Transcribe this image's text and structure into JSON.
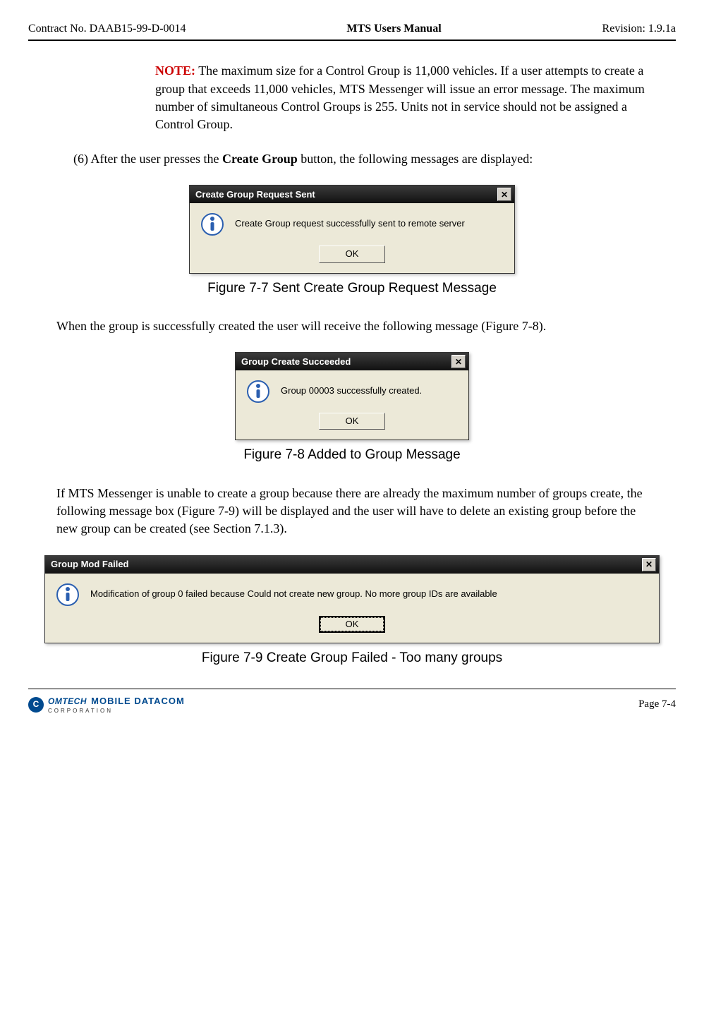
{
  "header": {
    "left": "Contract No. DAAB15-99-D-0014",
    "center": "MTS Users Manual",
    "right": "Revision:  1.9.1a"
  },
  "note": {
    "label": "NOTE:",
    "text": " The maximum size for a Control Group is 11,000 vehicles. If a user attempts to create a group that exceeds 11,000 vehicles, MTS Messenger will issue an error message.  The maximum number of simultaneous Control Groups is 255. Units not in service should not be assigned a Control Group."
  },
  "item6": {
    "number": "(6)",
    "pre": " After the user presses the ",
    "bold": "Create Group",
    "post": " button, the following messages are displayed:"
  },
  "dialog1": {
    "title": "Create Group Request Sent",
    "message": "Create Group request successfully sent to remote server",
    "ok": "OK"
  },
  "caption1": "Figure 7-7     Sent Create Group Request Message",
  "para2": "When the group is successfully created the user will receive the following message (Figure 7-8).",
  "dialog2": {
    "title": "Group Create Succeeded",
    "message": "Group 00003 successfully created.",
    "ok": "OK"
  },
  "caption2": "Figure 7-8     Added to Group Message",
  "para3": "If MTS Messenger is unable to create a group because there are already the maximum number of groups create, the following message box (Figure 7-9) will be displayed and the user will have to delete an existing group before the new group can be created (see Section 7.1.3).",
  "dialog3": {
    "title": "Group Mod Failed",
    "message": "Modification of group 0 failed because Could not create new group.  No more group IDs are available",
    "ok": "OK"
  },
  "caption3": "Figure 7-9     Create Group Failed - Too many groups",
  "footer": {
    "logo_brand": "OMTECH",
    "logo_brand2": "MOBILE DATACOM",
    "logo_sub": "CORPORATION",
    "page": "Page 7-4"
  }
}
